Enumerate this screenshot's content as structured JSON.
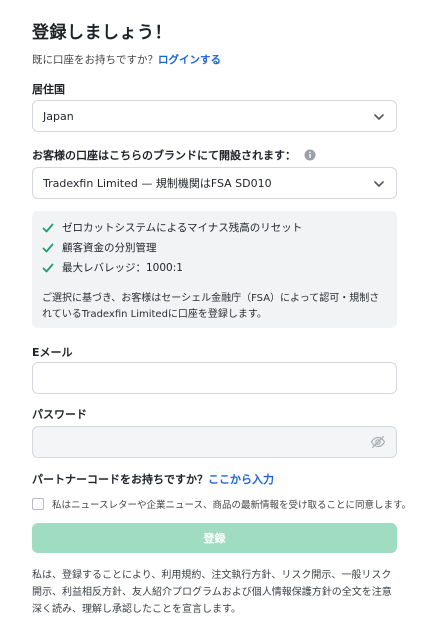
{
  "title": "登録しましょう！",
  "login_prompt": "既に口座をお持ちですか？",
  "login_link": "ログインする",
  "country": {
    "label": "居住国",
    "value": "Japan"
  },
  "brand": {
    "label": "お客様の口座はこちらのブランドにて開設されます：",
    "value": "Tradexfin Limited — 規制機関はFSA SD010"
  },
  "features": [
    "ゼロカットシステムによるマイナス残高のリセット",
    "顧客資金の分別管理",
    "最大レバレッジ：1000:1"
  ],
  "feature_note": "ご選択に基づき、お客様はセーシェル金融庁（FSA）によって認可・規制されているTradexfin Limitedに口座を登録します。",
  "email": {
    "label": "Eメール",
    "value": ""
  },
  "password": {
    "label": "パスワード",
    "value": ""
  },
  "partner_prompt": "パートナーコードをお持ちですか？",
  "partner_link": "ここから入力",
  "newsletter_label": "私はニュースレターや企業ニュース、商品の最新情報を受け取ることに同意します。",
  "submit_label": "登録",
  "terms": "私は、登録することにより、利用規約、注文執行方針、リスク開示、一般リスク開示、利益相反方針、友人紹介プログラムおよび個人情報保護方針の全文を注意深く読み、理解し承認したことを宣言します。",
  "colors": {
    "accent_link": "#1a64d6",
    "check_green": "#1e9e6a",
    "submit_disabled": "#9fdcc2"
  },
  "icons": [
    "chevron-down-icon",
    "info-icon",
    "check-icon",
    "eye-off-icon"
  ]
}
